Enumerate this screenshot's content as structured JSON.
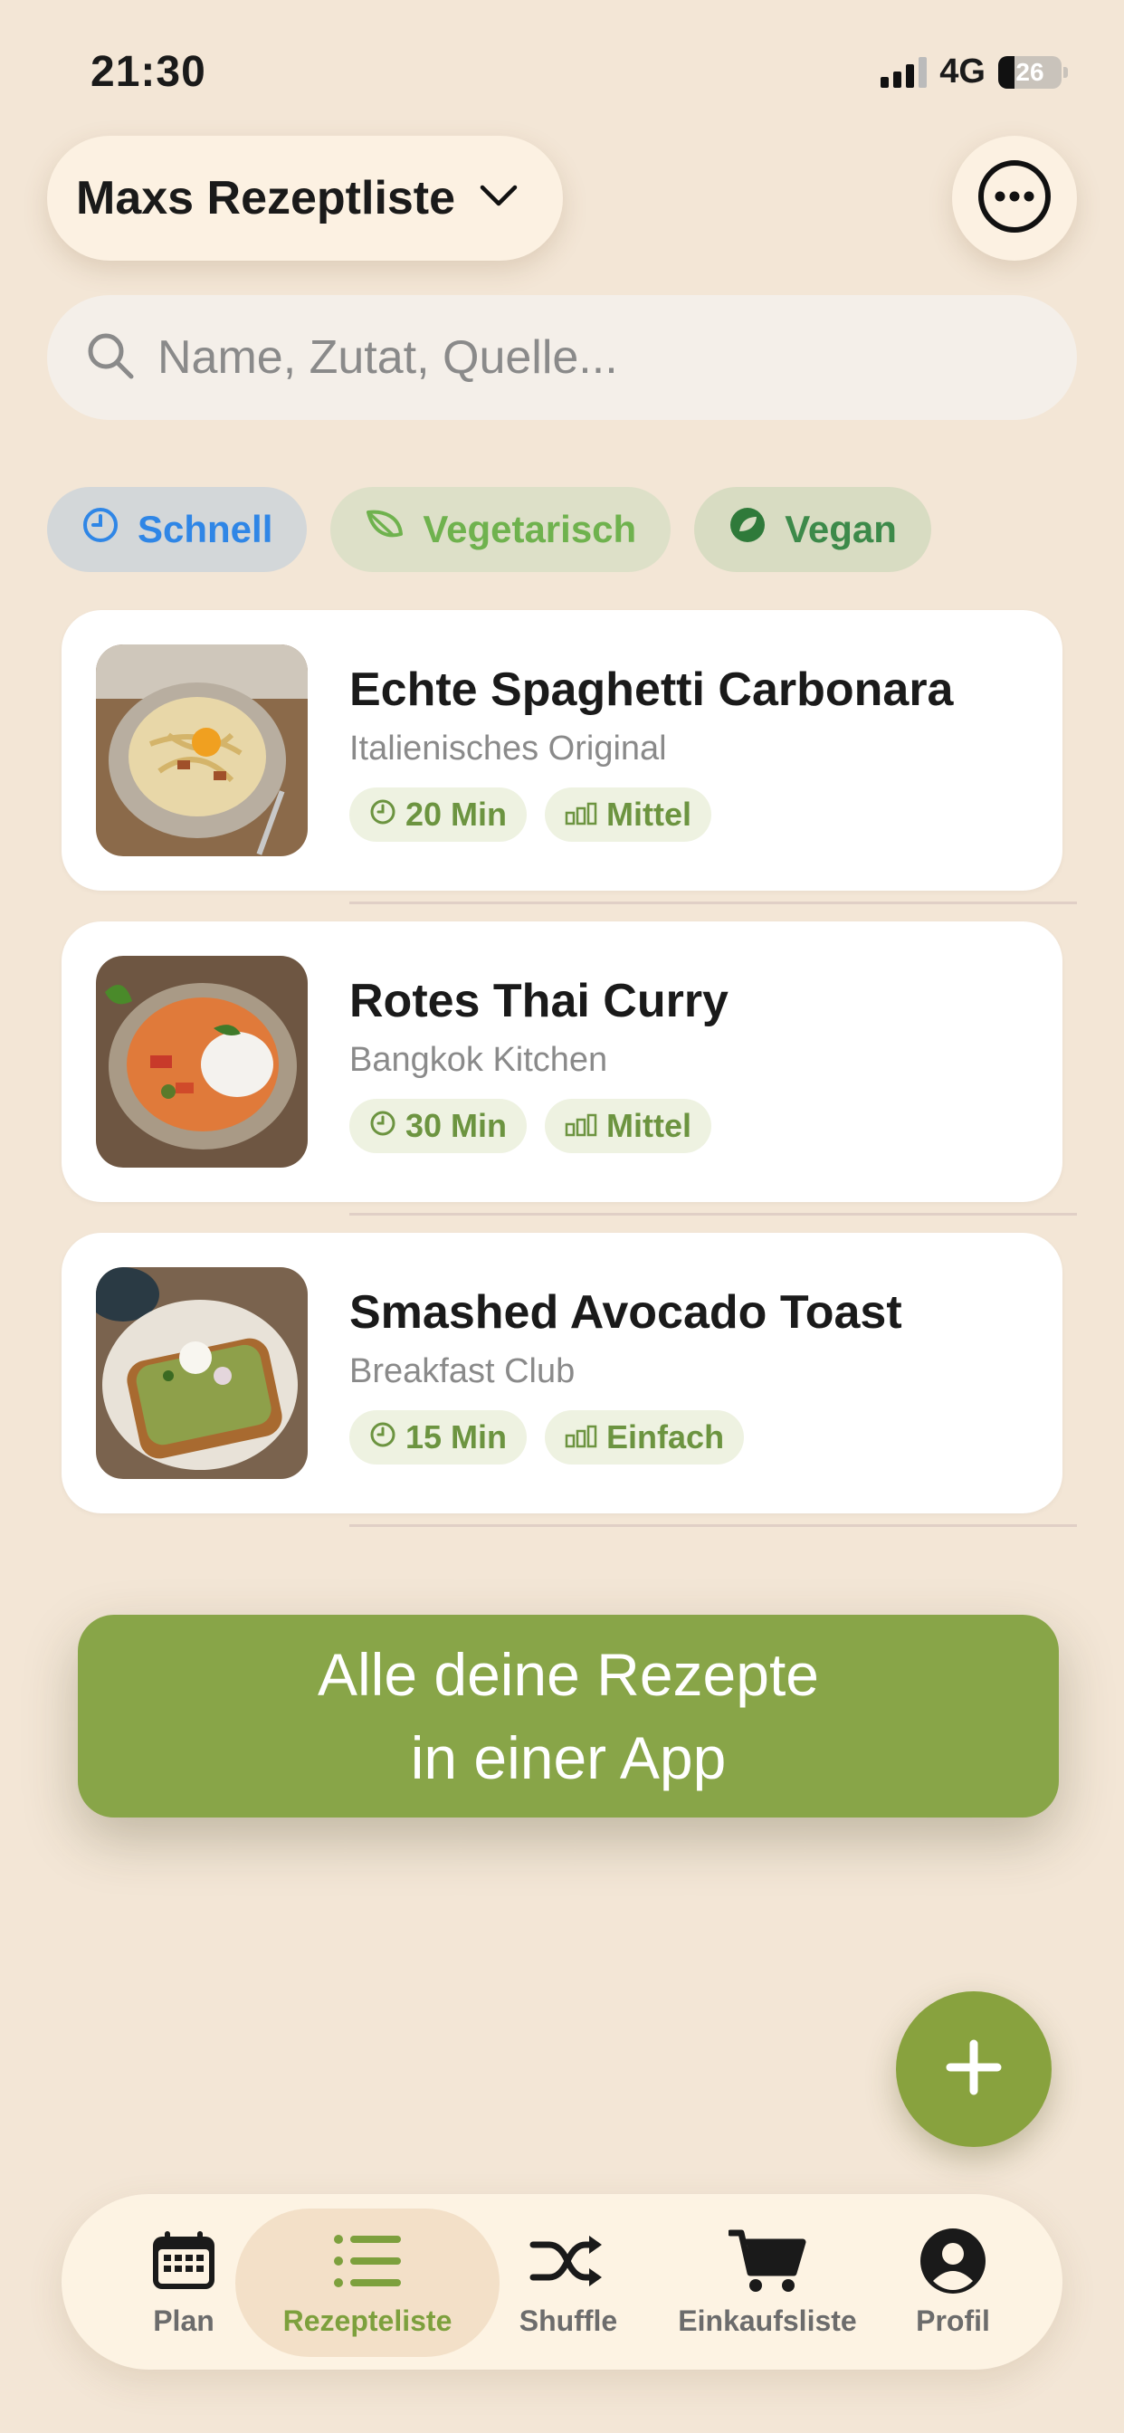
{
  "status_bar": {
    "time": "21:30",
    "network": "4G",
    "battery": "26",
    "battery_fraction": 0.26
  },
  "header": {
    "list_title": "Maxs Rezeptliste"
  },
  "search": {
    "placeholder": "Name, Zutat, Quelle..."
  },
  "filters": [
    {
      "label": "Schnell",
      "icon": "clock-icon"
    },
    {
      "label": "Vegetarisch",
      "icon": "leaf-icon"
    },
    {
      "label": "Vegan",
      "icon": "vegan-leaf-icon"
    }
  ],
  "recipes": [
    {
      "title": "Echte Spaghetti Carbonara",
      "source": "Italienisches Original",
      "time": "20 Min",
      "difficulty": "Mittel"
    },
    {
      "title": "Rotes Thai Curry",
      "source": "Bangkok Kitchen",
      "time": "30 Min",
      "difficulty": "Mittel"
    },
    {
      "title": "Smashed Avocado Toast",
      "source": "Breakfast Club",
      "time": "15 Min",
      "difficulty": "Einfach"
    }
  ],
  "banner": {
    "line1": "Alle deine Rezepte",
    "line2": "in einer App"
  },
  "tabs": [
    {
      "label": "Plan",
      "icon": "calendar-icon"
    },
    {
      "label": "Rezepteliste",
      "icon": "list-icon",
      "active": true
    },
    {
      "label": "Shuffle",
      "icon": "shuffle-icon"
    },
    {
      "label": "Einkaufsliste",
      "icon": "cart-icon"
    },
    {
      "label": "Profil",
      "icon": "profile-icon"
    }
  ],
  "colors": {
    "accent": "#88a548",
    "background": "#f3e6d6",
    "active_tab": "#7da03d",
    "chip_blue": "#2f86e6",
    "chip_green": "#6fb24e"
  }
}
